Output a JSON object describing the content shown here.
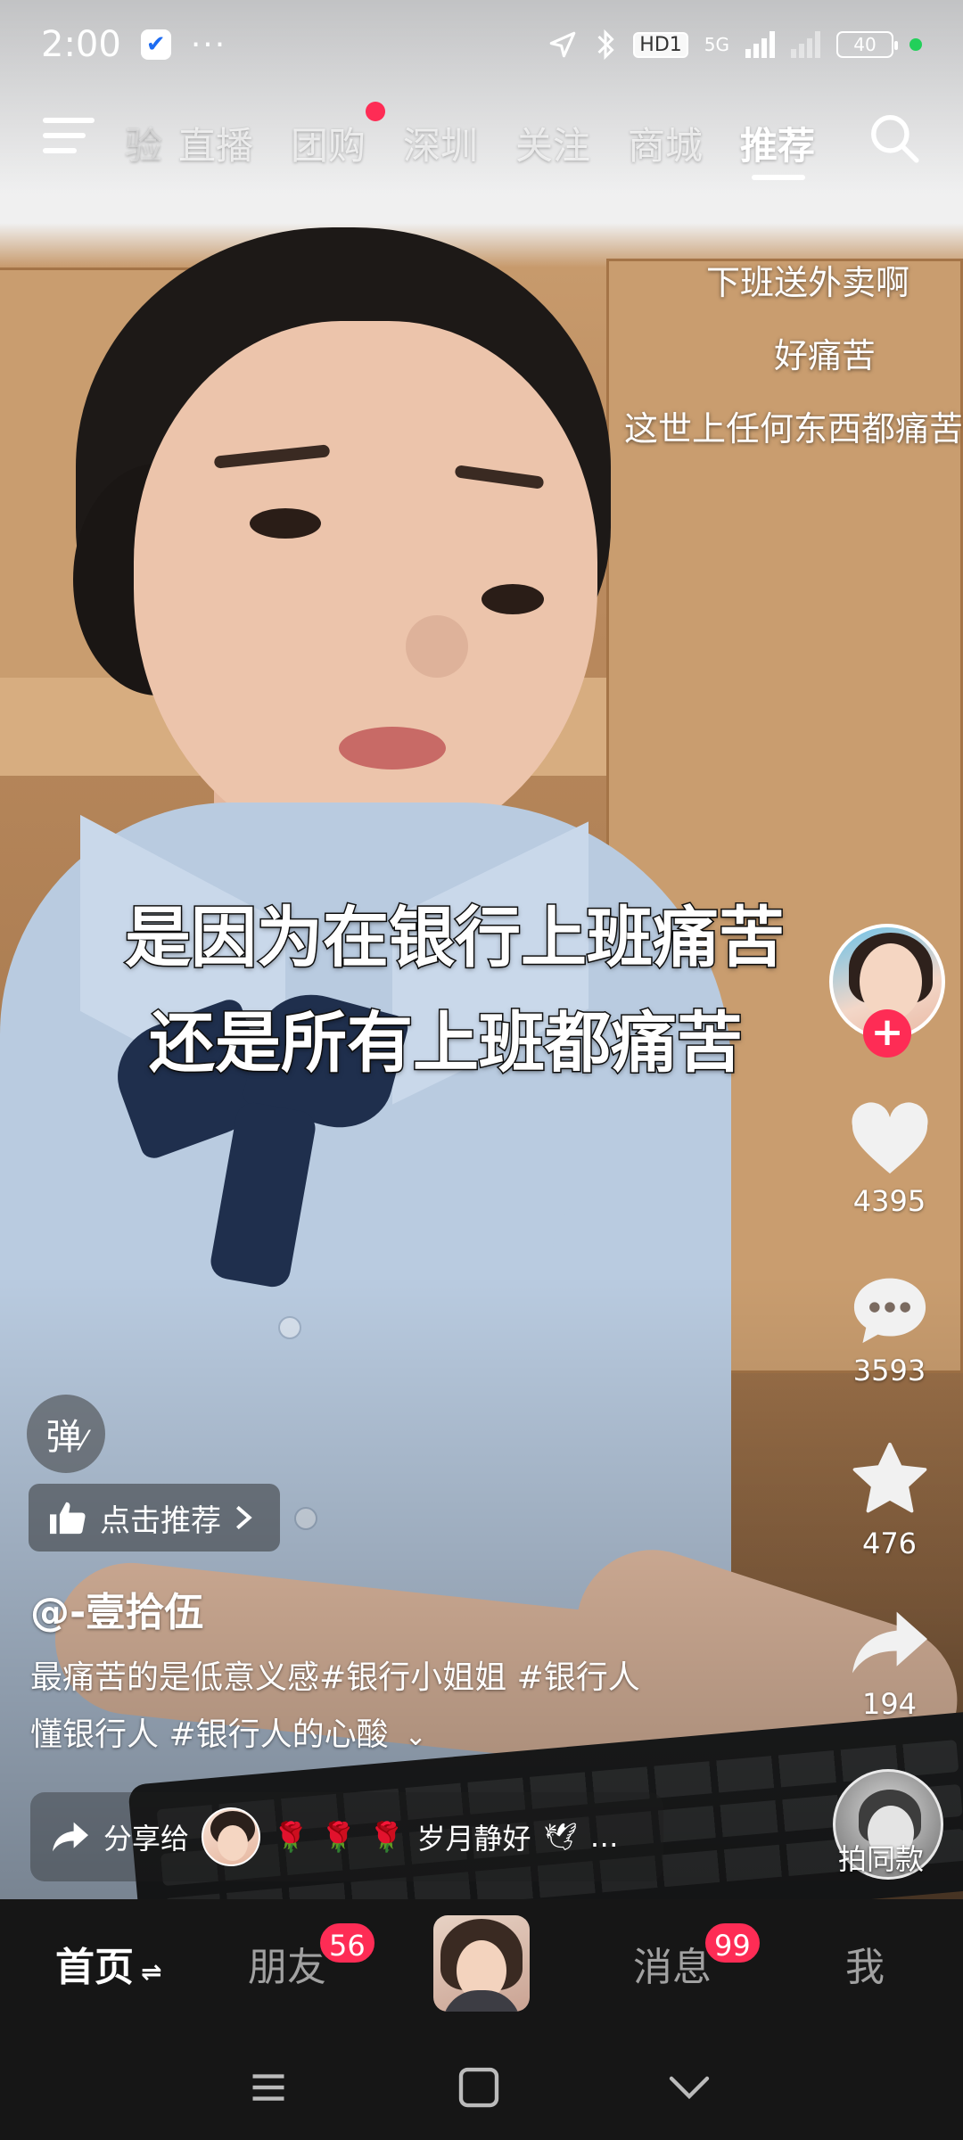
{
  "status_bar": {
    "time": "2:00",
    "more": "···",
    "hd_badge": "HD1",
    "network": "5G",
    "battery": "40"
  },
  "top_nav": {
    "tabs": [
      {
        "label": "直播"
      },
      {
        "label": "团购"
      },
      {
        "label": "深圳"
      },
      {
        "label": "关注"
      },
      {
        "label": "商城"
      },
      {
        "label": "推荐"
      }
    ],
    "active_tab": "推荐"
  },
  "lyrics": [
    "下班送外卖啊",
    "好痛苦",
    "这世上任何东西都痛苦"
  ],
  "caption": {
    "line1": "是因为在银行上班痛苦",
    "line2": "还是所有上班都痛苦"
  },
  "actions": {
    "likes": "4395",
    "comments": "3593",
    "favorites": "476",
    "shares": "194",
    "follow_plus": "+"
  },
  "overlay": {
    "danmu_label": "弹",
    "recommend_label": "点击推荐",
    "author": "@-壹拾伍",
    "desc_line1": "最痛苦的是低意义感#银行小姐姐 #银行人",
    "desc_line2": "懂银行人 #银行人的心酸",
    "share_label": "分享给",
    "share_target": "岁月静好",
    "share_more": "…",
    "same_style_label": "拍同款"
  },
  "tab_bar": {
    "home": "首页",
    "home_switch": "⇌",
    "friends": "朋友",
    "friends_badge": "56",
    "messages": "消息",
    "messages_badge": "99",
    "me": "我"
  },
  "colors": {
    "accent": "#fe2c55",
    "tabbar_bg": "#161616"
  }
}
